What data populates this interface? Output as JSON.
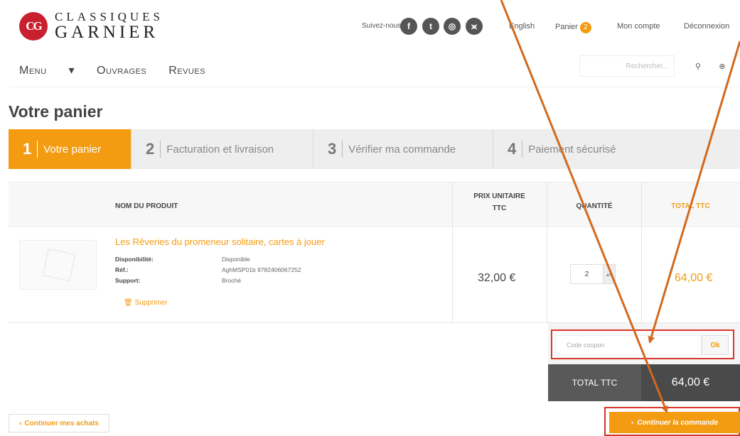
{
  "header": {
    "logo": {
      "badge": "CG",
      "line1": "CLASSIQUES",
      "line2": "GARNIER"
    },
    "follow_label": "Suivez-nous",
    "social": [
      {
        "icon": "facebook-icon",
        "glyph": "f"
      },
      {
        "icon": "twitter-icon",
        "glyph": "t"
      },
      {
        "icon": "instagram-icon",
        "glyph": "◎"
      },
      {
        "icon": "rss-icon",
        "glyph": "⪤"
      }
    ],
    "links": {
      "language": "English",
      "cart": "Panier",
      "cart_count": "2",
      "account": "Mon compte",
      "logout": "Déconnexion"
    }
  },
  "nav": {
    "menu": "Menu",
    "ouvrages": "Ouvrages",
    "revues": "Revues"
  },
  "search": {
    "placeholder": "Rechercher..."
  },
  "page_title": "Votre panier",
  "steps": [
    {
      "num": "1",
      "label": "Votre panier",
      "active": true
    },
    {
      "num": "2",
      "label": "Facturation et livraison"
    },
    {
      "num": "3",
      "label": "Vérifier ma commande"
    },
    {
      "num": "4",
      "label": "Paiement sécurisé"
    }
  ],
  "table": {
    "headers": {
      "product": "NOM DU PRODUIT",
      "unit_price_1": "PRIX UNITAIRE",
      "unit_price_2": "TTC",
      "quantity": "QUANTITÉ",
      "total": "TOTAL TTC"
    },
    "item": {
      "name": "Les Rêveries du promeneur solitaire, cartes à jouer",
      "availability_label": "Disponibilité:",
      "availability": "Disponible",
      "ref_label": "Réf.:",
      "ref": "AghMSP01b 9782406067252",
      "support_label": "Support:",
      "support": "Broché",
      "remove": "Supprimer",
      "unit_price": "32,00 €",
      "quantity": "2",
      "line_total": "64,00 €"
    }
  },
  "coupon": {
    "placeholder": "Code coupon",
    "button": "Ok"
  },
  "total": {
    "label": "TOTAL TTC",
    "value": "64,00 €"
  },
  "buttons": {
    "back": "Continuer mes achats",
    "continue": "Continuer la commande"
  },
  "colors": {
    "accent": "#f39c12",
    "annotation_red": "#d9342b",
    "arrow": "#d2691e"
  }
}
